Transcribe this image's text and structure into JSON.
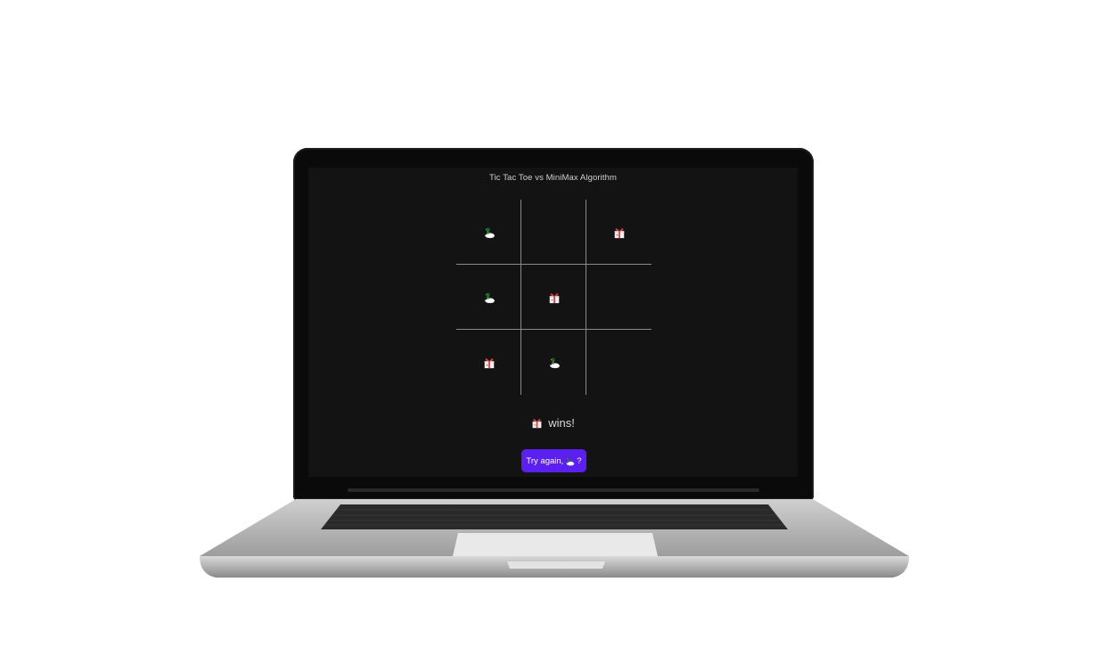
{
  "app": {
    "title": "Tic Tac Toe vs MiniMax Algorithm"
  },
  "players": {
    "human": {
      "icon": "duck-icon"
    },
    "ai": {
      "icon": "gift-icon"
    }
  },
  "board": {
    "cells": [
      "human",
      "",
      "ai",
      "human",
      "ai",
      "",
      "ai",
      "human",
      ""
    ]
  },
  "result": {
    "winner": "ai",
    "text": "wins!"
  },
  "retry_button": {
    "label_prefix": "Try again, ",
    "label_suffix": "?",
    "color": "#5b1ff0"
  },
  "colors": {
    "screen_bg": "#131313",
    "grid": "#8a8a8a",
    "text": "#d8d8d8"
  }
}
